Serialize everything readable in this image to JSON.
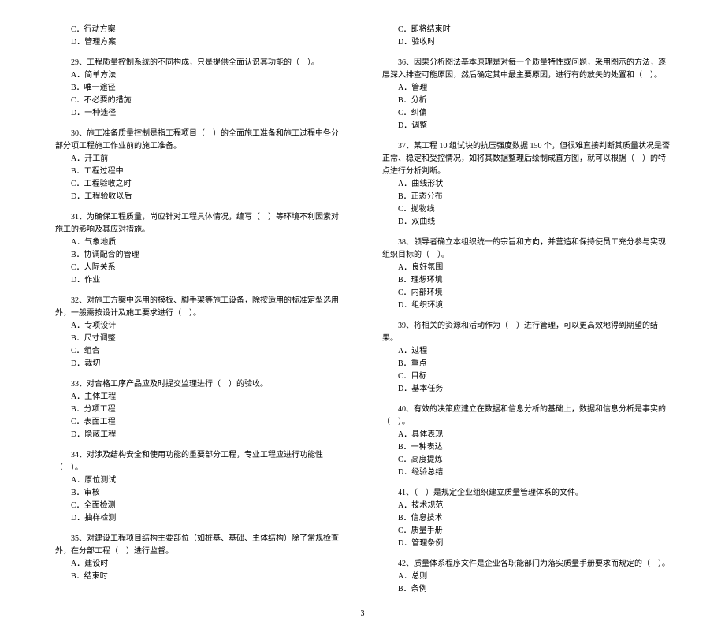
{
  "page_number": "3",
  "left": {
    "q28_tail": {
      "c": "C．行动方案",
      "d": "D．管理方案"
    },
    "q29": {
      "stem": "29、工程质量控制系统的不同构成，只是提供全面认识其功能的（　）。",
      "a": "A．简单方法",
      "b": "B．唯一途径",
      "c": "C．不必要的措施",
      "d": "D．一种途径"
    },
    "q30": {
      "stem": "30、施工准备质量控制是指工程项目（　）的全面施工准备和施工过程中各分部分项工程施工作业前的施工准备。",
      "a": "A．开工前",
      "b": "B．工程过程中",
      "c": "C．工程验收之时",
      "d": "D．工程验收以后"
    },
    "q31": {
      "stem": "31、为确保工程质量，尚应针对工程具体情况，编写（　）等环境不利因素对施工的影响及其应对措施。",
      "a": "A．气象地质",
      "b": "B．协调配合的管理",
      "c": "C．人际关系",
      "d": "D．作业"
    },
    "q32": {
      "stem": "32、对施工方案中选用的模板、脚手架等施工设备，除按适用的标准定型选用外，一般需按设计及施工要求进行（　）。",
      "a": "A．专项设计",
      "b": "B．尺寸调整",
      "c": "C．组合",
      "d": "D．裁切"
    },
    "q33": {
      "stem": "33、对合格工序产品应及时提交监理进行（　）的验收。",
      "a": "A．主体工程",
      "b": "B．分项工程",
      "c": "C．表面工程",
      "d": "D．隐蔽工程"
    },
    "q34": {
      "stem": "34、对涉及结构安全和使用功能的重要部分工程，专业工程应进行功能性（　）。",
      "a": "A．原位测试",
      "b": "B．审核",
      "c": "C．全面检测",
      "d": "D．抽样检测"
    },
    "q35": {
      "stem": "35、对建设工程项目结构主要部位（如桩基、基础、主体结构）除了常规检查外，在分部工程（　）进行监督。",
      "a": "A．建设时",
      "b": "B．结束时"
    }
  },
  "right": {
    "q35_tail": {
      "c": "C．即将结束时",
      "d": "D．验收时"
    },
    "q36": {
      "stem": "36、因果分析图法基本原理是对每一个质量特性或问题，采用图示的方法，逐层深入排查可能原因，然后确定其中最主要原因，进行有的放矢的处置和（　）。",
      "a": "A．管理",
      "b": "B．分析",
      "c": "C．纠偏",
      "d": "D．调整"
    },
    "q37": {
      "stem": "37、某工程 10 组试块的抗压强度数据 150 个，但很难直接判断其质量状况是否正常、稳定和受控情况，如将其数据整理后绘制成直方图，就可以根据（　）的特点进行分析判断。",
      "a": "A．曲线形状",
      "b": "B．正态分布",
      "c": "C．抛物线",
      "d": "D．双曲线"
    },
    "q38": {
      "stem": "38、领导者确立本组织统一的宗旨和方向，并营造和保持使员工充分参与实现组织目标的（　）。",
      "a": "A．良好氛围",
      "b": "B．理想环境",
      "c": "C．内部环境",
      "d": "D．组织环境"
    },
    "q39": {
      "stem": "39、将相关的资源和活动作为（　）进行管理，可以更高效地得到期望的结果。",
      "a": "A．过程",
      "b": "B．重点",
      "c": "C．目标",
      "d": "D．基本任务"
    },
    "q40": {
      "stem": "40、有效的决策应建立在数据和信息分析的基础上，数据和信息分析是事实的（　）。",
      "a": "A．具体表现",
      "b": "B．一种表达",
      "c": "C．高度提炼",
      "d": "D．经验总结"
    },
    "q41": {
      "stem": "41、（　）是规定企业组织建立质量管理体系的文件。",
      "a": "A．技术规范",
      "b": "B．信息技术",
      "c": "C．质量手册",
      "d": "D．管理条例"
    },
    "q42": {
      "stem": "42、质量体系程序文件是企业各职能部门为落实质量手册要求而规定的（　）。",
      "a": "A．总则",
      "b": "B．条例"
    }
  }
}
